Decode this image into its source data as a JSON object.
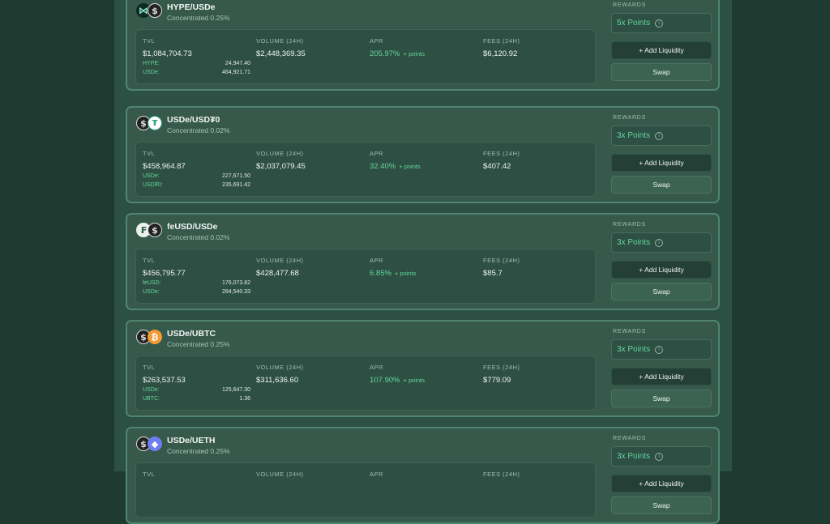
{
  "pools": [
    {
      "pair": "HYPE/USDe",
      "fee_tier": "Concentrated 0.25%",
      "icons": [
        "hype-icon",
        "usde-icon"
      ],
      "tvl": "$1,084,704.73",
      "volume": "$2,448,369.35",
      "apr": "205.97%",
      "apr_points": "+ points",
      "fees": "$6,120.92",
      "tokens": [
        {
          "name": "HYPE:",
          "amount": "24,947.40"
        },
        {
          "name": "USDe:",
          "amount": "464,921.71"
        }
      ],
      "rewards": "5x Points"
    },
    {
      "pair": "USDe/USD₮0",
      "fee_tier": "Concentrated 0.02%",
      "icons": [
        "usde-icon",
        "usdt0-icon"
      ],
      "tvl": "$458,964.87",
      "volume": "$2,037,079.45",
      "apr": "32.40%",
      "apr_points": "+ points",
      "fees": "$407.42",
      "tokens": [
        {
          "name": "USDe:",
          "amount": "227,671.50"
        },
        {
          "name": "USD₮0:",
          "amount": "235,691.42"
        }
      ],
      "rewards": "3x Points"
    },
    {
      "pair": "feUSD/USDe",
      "fee_tier": "Concentrated 0.02%",
      "icons": [
        "feusd-icon",
        "usde-icon"
      ],
      "tvl": "$456,795.77",
      "volume": "$428,477.68",
      "apr": "6.85%",
      "apr_points": "+ points",
      "fees": "$85.7",
      "tokens": [
        {
          "name": "feUSD:",
          "amount": "176,073.82"
        },
        {
          "name": "USDe:",
          "amount": "284,540.33"
        }
      ],
      "rewards": "3x Points"
    },
    {
      "pair": "USDe/UBTC",
      "fee_tier": "Concentrated 0.25%",
      "icons": [
        "usde-icon",
        "ubtc-icon"
      ],
      "tvl": "$263,537.53",
      "volume": "$311,636.60",
      "apr": "107.90%",
      "apr_points": "+ points",
      "fees": "$779.09",
      "tokens": [
        {
          "name": "USDe:",
          "amount": "125,647.30"
        },
        {
          "name": "UBTC:",
          "amount": "1.36"
        }
      ],
      "rewards": "3x Points"
    },
    {
      "pair": "USDe/UETH",
      "fee_tier": "Concentrated 0.25%",
      "icons": [
        "usde-icon",
        "ueth-icon"
      ],
      "tvl": "",
      "volume": "",
      "apr": "",
      "apr_points": "",
      "fees": "",
      "tokens": [],
      "rewards": "3x Points"
    }
  ],
  "labels": {
    "tvl": "TVL",
    "volume": "VOLUME (24H)",
    "apr": "APR",
    "fees": "FEES (24H)",
    "rewards": "REWARDS",
    "add_liquidity": "+ Add Liquidity",
    "swap": "Swap",
    "info": "i"
  },
  "coin_glyphs": {
    "usde-icon": "$",
    "hype-icon": "⋈",
    "usdt0-icon": "₮",
    "feusd-icon": "₣",
    "ubtc-icon": "₿",
    "ueth-icon": "◆"
  },
  "colors": {
    "background": "#1f3a31",
    "card": "#36594c",
    "card_border": "#4f8570",
    "accent_green": "#62d69f"
  }
}
